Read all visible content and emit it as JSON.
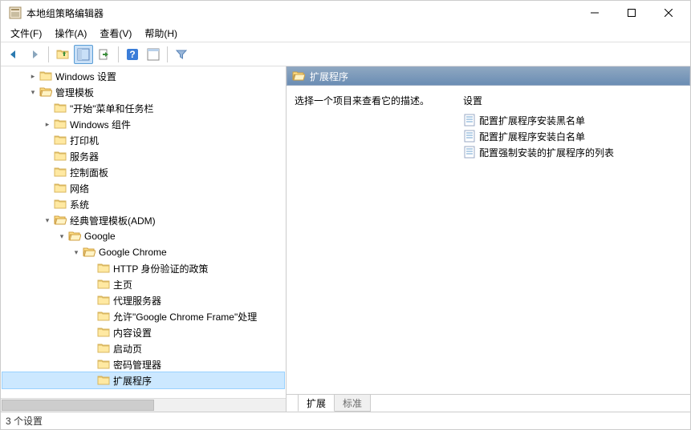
{
  "window": {
    "title": "本地组策略编辑器"
  },
  "menu": {
    "file": "文件(F)",
    "action": "操作(A)",
    "view": "查看(V)",
    "help": "帮助(H)"
  },
  "tree": [
    {
      "level": 0,
      "exp": "closed",
      "label": "Windows 设置"
    },
    {
      "level": 0,
      "exp": "open",
      "label": "管理模板"
    },
    {
      "level": 1,
      "exp": "none",
      "label": "\"开始\"菜单和任务栏"
    },
    {
      "level": 1,
      "exp": "closed",
      "label": "Windows 组件"
    },
    {
      "level": 1,
      "exp": "none",
      "label": "打印机"
    },
    {
      "level": 1,
      "exp": "none",
      "label": "服务器"
    },
    {
      "level": 1,
      "exp": "none",
      "label": "控制面板"
    },
    {
      "level": 1,
      "exp": "none",
      "label": "网络"
    },
    {
      "level": 1,
      "exp": "none",
      "label": "系统"
    },
    {
      "level": 1,
      "exp": "open",
      "label": "经典管理模板(ADM)"
    },
    {
      "level": 2,
      "exp": "open",
      "label": "Google"
    },
    {
      "level": 3,
      "exp": "open",
      "label": "Google Chrome"
    },
    {
      "level": 4,
      "exp": "none",
      "label": "HTTP 身份验证的政策"
    },
    {
      "level": 4,
      "exp": "none",
      "label": "主页"
    },
    {
      "level": 4,
      "exp": "none",
      "label": "代理服务器"
    },
    {
      "level": 4,
      "exp": "none",
      "label": "允许\"Google Chrome Frame\"处理"
    },
    {
      "level": 4,
      "exp": "none",
      "label": "内容设置"
    },
    {
      "level": 4,
      "exp": "none",
      "label": "启动页"
    },
    {
      "level": 4,
      "exp": "none",
      "label": "密码管理器"
    },
    {
      "level": 4,
      "exp": "none",
      "label": "扩展程序",
      "selected": true
    }
  ],
  "right": {
    "header": "扩展程序",
    "instruction": "选择一个项目来查看它的描述。",
    "column": "设置",
    "items": [
      "配置扩展程序安装黑名单",
      "配置扩展程序安装白名单",
      "配置强制安装的扩展程序的列表"
    ]
  },
  "tabs": {
    "ext": "扩展",
    "std": "标准"
  },
  "status": "3 个设置"
}
